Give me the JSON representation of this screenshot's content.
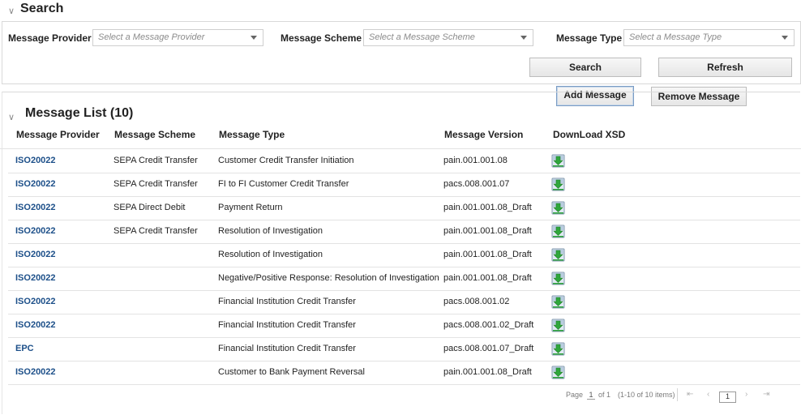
{
  "search": {
    "title": "Search",
    "provider_label": "Message Provider",
    "provider_placeholder": "Select a Message Provider",
    "scheme_label": "Message Scheme",
    "scheme_placeholder": "Select a Message Scheme",
    "type_label": "Message Type",
    "type_placeholder": "Select a Message Type",
    "search_button": "Search",
    "refresh_button": "Refresh"
  },
  "actions": {
    "add_button": "Add Message",
    "remove_button": "Remove Message"
  },
  "list": {
    "title": "Message List (10)",
    "columns": [
      "Message Provider",
      "Message Scheme",
      "Message Type",
      "Message Version",
      "DownLoad XSD"
    ],
    "rows": [
      {
        "provider": "ISO20022",
        "scheme": "SEPA Credit Transfer",
        "type": "Customer Credit Transfer Initiation",
        "version": "pain.001.001.08"
      },
      {
        "provider": "ISO20022",
        "scheme": "SEPA Credit Transfer",
        "type": "FI to FI Customer Credit Transfer",
        "version": "pacs.008.001.07"
      },
      {
        "provider": "ISO20022",
        "scheme": "SEPA Direct Debit",
        "type": "Payment Return",
        "version": "pain.001.001.08_Draft"
      },
      {
        "provider": "ISO20022",
        "scheme": "SEPA Credit Transfer",
        "type": "Resolution of Investigation",
        "version": "pain.001.001.08_Draft"
      },
      {
        "provider": "ISO20022",
        "scheme": "",
        "type": "Resolution of Investigation",
        "version": "pain.001.001.08_Draft"
      },
      {
        "provider": "ISO20022",
        "scheme": "",
        "type": "Negative/Positive Response: Resolution of Investigation",
        "version": "pain.001.001.08_Draft"
      },
      {
        "provider": "ISO20022",
        "scheme": "",
        "type": "Financial Institution Credit Transfer",
        "version": "pacs.008.001.02"
      },
      {
        "provider": "ISO20022",
        "scheme": "",
        "type": "Financial Institution Credit Transfer",
        "version": "pacs.008.001.02_Draft"
      },
      {
        "provider": "EPC",
        "scheme": "",
        "type": "Financial Institution Credit Transfer",
        "version": "pacs.008.001.07_Draft"
      },
      {
        "provider": "ISO20022",
        "scheme": "",
        "type": "Customer to Bank Payment Reversal",
        "version": "pain.001.001.08_Draft"
      }
    ],
    "download_icon": "download-xsd-icon"
  },
  "pagination": {
    "page_label": "Page",
    "page_value": "1",
    "of_label": "of 1",
    "items_label": "(1-10 of 10 items)",
    "current_page": "1"
  }
}
